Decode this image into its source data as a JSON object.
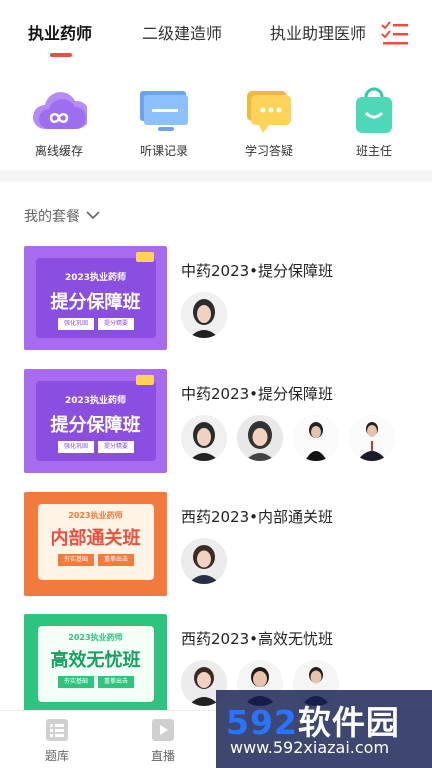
{
  "tabs": [
    {
      "label": "执业药师",
      "active": true
    },
    {
      "label": "二级建造师",
      "active": false
    },
    {
      "label": "执业助理医师",
      "active": false
    }
  ],
  "menu_icon": "list-menu-icon",
  "quick_actions": [
    {
      "label": "离线缓存",
      "icon": "cloud-icon"
    },
    {
      "label": "听课记录",
      "icon": "monitor-icon"
    },
    {
      "label": "学习答疑",
      "icon": "chat-bubble-icon"
    },
    {
      "label": "班主任",
      "icon": "bag-icon"
    }
  ],
  "section": {
    "title": "我的套餐"
  },
  "courses": [
    {
      "title": "中药2023•提分保障班",
      "thumb": {
        "line1": "2023执业药师",
        "line2": "提分保障班",
        "sub1": "强化巩固",
        "sub2": "提分精要"
      }
    },
    {
      "title": "中药2023•提分保障班",
      "thumb": {
        "line1": "2023执业药师",
        "line2": "提分保障班",
        "sub1": "强化巩固",
        "sub2": "提分精要"
      }
    },
    {
      "title": "西药2023•内部通关班",
      "thumb": {
        "line1": "2023执业药师",
        "line2": "内部通关班",
        "sub1": "夯实基础",
        "sub2": "重拳出击"
      }
    },
    {
      "title": "西药2023•高效无忧班",
      "thumb": {
        "line1": "2023执业药师",
        "line2": "高效无忧班",
        "sub1": "夯实基础",
        "sub2": "重拳出击"
      }
    }
  ],
  "bottom_nav": [
    {
      "label": "题库",
      "icon": "question-bank-icon"
    },
    {
      "label": "直播",
      "icon": "play-icon"
    }
  ],
  "watermark": {
    "logo": "592软件园",
    "url": "www.592xiazai.com"
  },
  "colors": {
    "accent": "#e8503d",
    "purple": "#a86bf0",
    "orange": "#f27a3c",
    "green": "#2ec47f"
  }
}
